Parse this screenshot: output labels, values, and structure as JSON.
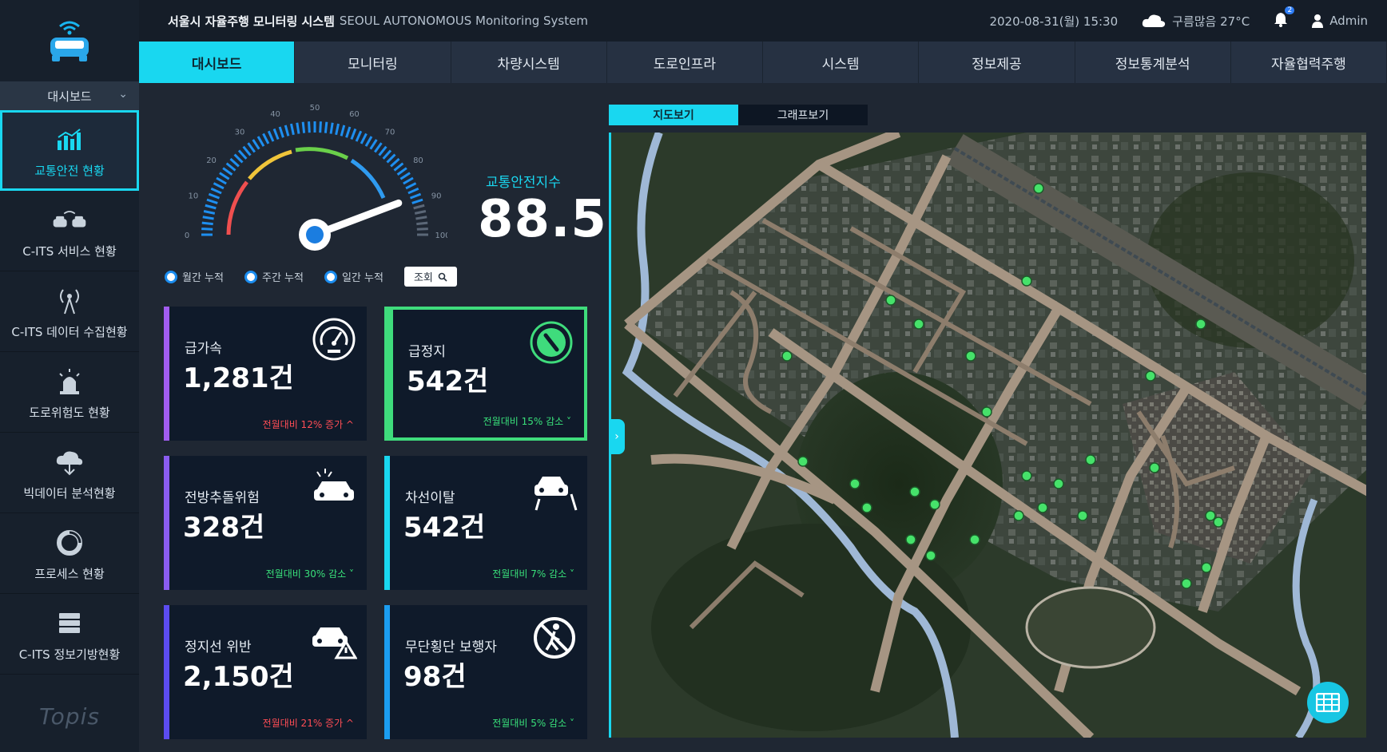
{
  "topbar": {
    "system_kr": "서울시 자율주행 모니터링 시스템",
    "system_en": "SEOUL AUTONOMOUS Monitoring System",
    "datetime": "2020-08-31(월) 15:30",
    "weather": "구름많음 27°C",
    "notification_count": "2",
    "user": "Admin"
  },
  "nav": {
    "tabs": [
      "대시보드",
      "모니터링",
      "차량시스템",
      "도로인프라",
      "시스템",
      "정보제공",
      "정보통계분석",
      "자율협력주행"
    ],
    "active_index": 0
  },
  "sidebar": {
    "section": "대시보드",
    "items": [
      {
        "label": "교통안전 현황",
        "icon": "chart-bar-icon"
      },
      {
        "label": "C-ITS 서비스 현황",
        "icon": "cars-icon"
      },
      {
        "label": "C-ITS 데이터 수집현황",
        "icon": "antenna-icon"
      },
      {
        "label": "도로위험도 현황",
        "icon": "warning-light-icon"
      },
      {
        "label": "빅데이터 분석현황",
        "icon": "cloud-icon"
      },
      {
        "label": "프로세스 현황",
        "icon": "pie-chart-icon"
      },
      {
        "label": "C-ITS 정보기방현황",
        "icon": "server-icon"
      }
    ],
    "active_index": 0,
    "brand": "Topis"
  },
  "gauge": {
    "ticks": [
      "0",
      "10",
      "20",
      "30",
      "40",
      "50",
      "60",
      "70",
      "80",
      "90",
      "100"
    ],
    "value": 88.5,
    "index_label": "교통안전지수",
    "index_value": "88.5"
  },
  "filters": {
    "options": [
      "월간 누적",
      "주간 누적",
      "일간 누적"
    ],
    "query_label": "조회"
  },
  "cards": [
    {
      "title": "급가속",
      "value": "1,281건",
      "compare": "전월대비 12% 증가 ^",
      "trend": "up",
      "bar_color": "#a15cf0",
      "icon": "speedometer-icon"
    },
    {
      "title": "급정지",
      "value": "542건",
      "compare": "전월대비 15% 감소 ˅",
      "trend": "down",
      "bar_color": "#3fdc7c",
      "icon": "brake-pedal-icon"
    },
    {
      "title": "전방추돌위험",
      "value": "328건",
      "compare": "전월대비 30% 감소 ˅",
      "trend": "down",
      "bar_color": "#8a5cf0",
      "icon": "car-collision-icon"
    },
    {
      "title": "차선이탈",
      "value": "542건",
      "compare": "전월대비 7% 감소 ˅",
      "trend": "down",
      "bar_color": "#19d7f0",
      "icon": "lane-departure-icon"
    },
    {
      "title": "정지선 위반",
      "value": "2,150건",
      "compare": "전월대비 21% 증가 ^",
      "trend": "up",
      "bar_color": "#5c4cf0",
      "icon": "car-warning-icon"
    },
    {
      "title": "무단횡단 보행자",
      "value": "98건",
      "compare": "전월대비 5% 감소 ˅",
      "trend": "down",
      "bar_color": "#1b9df0",
      "icon": "no-pedestrian-icon"
    }
  ],
  "map": {
    "tabs": [
      "지도보기",
      "그래프보기"
    ],
    "active_index": 0
  },
  "colors": {
    "accent": "#19d7f0",
    "increase": "#ff4d55",
    "decrease": "#39e07a",
    "marker": "#46e26a"
  }
}
